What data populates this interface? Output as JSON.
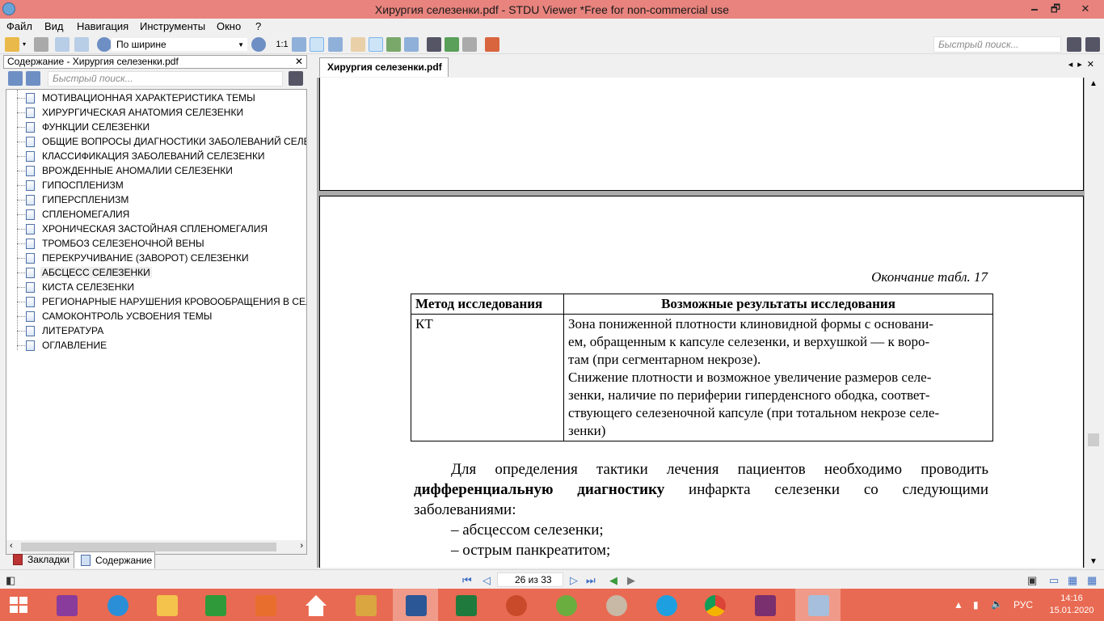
{
  "window": {
    "title": "Хирургия селезенки.pdf - STDU Viewer *Free for non-commercial use",
    "minimize": "🗕",
    "maximize": "🗗",
    "close": "✕"
  },
  "menu": [
    "Файл",
    "Вид",
    "Навигация",
    "Инструменты",
    "Окно",
    "?"
  ],
  "toolbar": {
    "zoom_label": "1:1",
    "zoom_mode": "По ширине",
    "search_placeholder": "Быстрый поиск..."
  },
  "left_panel": {
    "header": "Содержание - Хирургия селезенки.pdf",
    "close": "✕",
    "search_placeholder": "Быстрый поиск...",
    "items": [
      "МОТИВАЦИОННАЯ ХАРАКТЕРИСТИКА ТЕМЫ",
      "ХИРУРГИЧЕСКАЯ АНАТОМИЯ СЕЛЕЗЕНКИ",
      "ФУНКЦИИ СЕЛЕЗЕНКИ",
      "ОБЩИЕ ВОПРОСЫ ДИАГНОСТИКИ ЗАБОЛЕВАНИЙ СЕЛЕЗЕНКИ",
      "КЛАССИФИКАЦИЯ ЗАБОЛЕВАНИЙ СЕЛЕЗЕНКИ",
      "ВРОЖДЕННЫЕ АНОМАЛИИ СЕЛЕЗЕНКИ",
      "ГИПОСПЛЕНИЗМ",
      "ГИПЕРСПЛЕНИЗМ",
      "СПЛЕНОМЕГАЛИЯ",
      "ХРОНИЧЕСКАЯ ЗАСТОЙНАЯ СПЛЕНОМЕГАЛИЯ",
      "ТРОМБОЗ СЕЛЕЗЕНОЧНОЙ ВЕНЫ",
      "ПЕРЕКРУЧИВАНИЕ (ЗАВОРОТ) СЕЛЕЗЕНКИ",
      "АБСЦЕСС СЕЛЕЗЕНКИ",
      "КИСТА СЕЛЕЗЕНКИ",
      "РЕГИОНАРНЫЕ НАРУШЕНИЯ КРОВООБРАЩЕНИЯ В СЕЛЕЗЕНКЕ",
      "САМОКОНТРОЛЬ УСВОЕНИЯ ТЕМЫ",
      "ЛИТЕРАТУРА",
      "ОГЛАВЛЕНИЕ"
    ],
    "selected_item": "АБСЦЕСС СЕЛЕЗЕНКИ",
    "tabs": [
      "Закладки",
      "Содержание"
    ]
  },
  "document": {
    "tab": "Хирургия селезенки.pdf",
    "caption": "Окончание табл. 17",
    "table": {
      "headers": [
        "Метод исследования",
        "Возможные результаты исследования"
      ],
      "method": "КТ",
      "results": [
        "Зона пониженной плотности клиновидной формы с основани-",
        "ем, обращенным к капсуле селезенки, и верхушкой — к воро-",
        "там (при сегментарном некрозе).",
        "Снижение плотности и возможное увеличение размеров селе-",
        "зенки, наличие по периферии гиперденсного ободка, соответ-",
        "ствующего селезеночной капсуле (при тотальном некрозе селе-",
        "зенки)"
      ]
    },
    "paragraph_start": "Для определения тактики лечения пациентов необходимо проводить",
    "paragraph_bold": "дифференциальную диагностику",
    "paragraph_rest": "инфаркта селезенки со следующими заболеваниями:",
    "list": [
      "–  абсцессом селезенки;",
      "–  острым панкреатитом;"
    ]
  },
  "status": {
    "page_counter": "26 из 33"
  },
  "taskbar": {
    "language": "РУС",
    "time": "14:16",
    "date": "15.01.2020"
  },
  "colors": {
    "titlebar": "#e8837d",
    "taskbar": "#e96a52",
    "selection": "#cde4f7"
  }
}
